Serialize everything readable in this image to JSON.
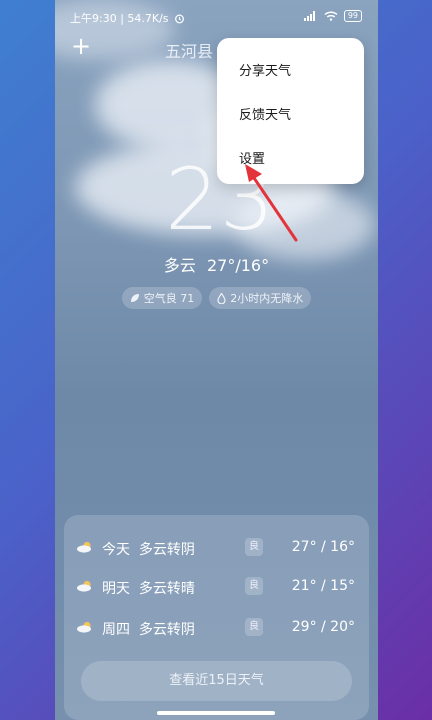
{
  "status_bar": {
    "left_text": "上午9:30 | 54.7K/s",
    "battery": "99"
  },
  "header": {
    "city": "五河县"
  },
  "current": {
    "temperature": "23",
    "condition": "多云",
    "range": "27°/16°",
    "air_quality": "空气良 71",
    "rain_forecast": "2小时内无降水"
  },
  "menu": {
    "items": [
      "分享天气",
      "反馈天气",
      "设置"
    ]
  },
  "forecast": {
    "rows": [
      {
        "day": "今天",
        "condition": "多云转阴",
        "aqi": "良",
        "range": "27° / 16°"
      },
      {
        "day": "明天",
        "condition": "多云转晴",
        "aqi": "良",
        "range": "21° / 15°"
      },
      {
        "day": "周四",
        "condition": "多云转阴",
        "aqi": "良",
        "range": "29° / 20°"
      }
    ],
    "more_label": "查看近15日天气"
  },
  "colors": {
    "arrow": "#e2343a",
    "menu_bg": "#ffffff"
  },
  "icons": [
    "add-icon",
    "alarm-icon",
    "signal-icon",
    "wifi-icon",
    "battery-icon",
    "leaf-icon",
    "droplet-icon",
    "cloud-icon"
  ]
}
